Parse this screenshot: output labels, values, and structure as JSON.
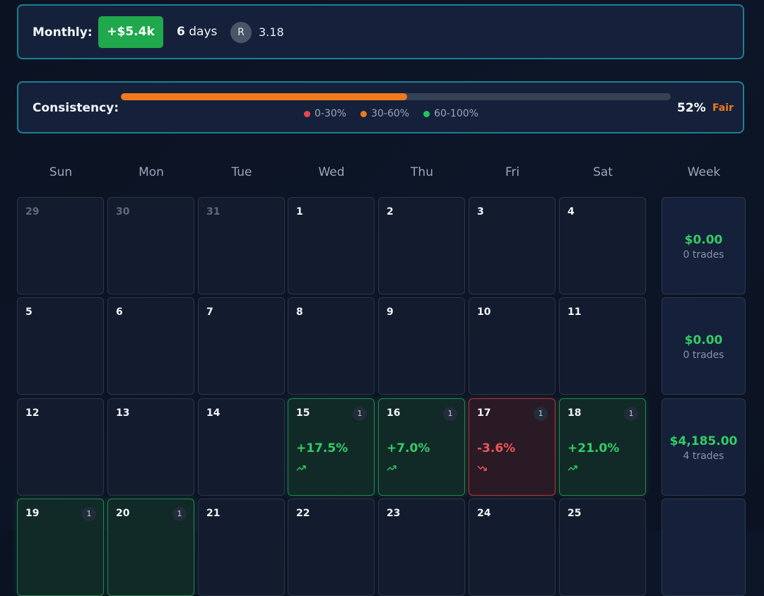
{
  "header": {
    "monthly_label": "Monthly:",
    "pnl": "+$5.4k",
    "days_value": "6",
    "days_unit": "days",
    "avatar_letter": "R",
    "ratio": "3.18"
  },
  "consistency": {
    "label": "Consistency:",
    "value": 0.52,
    "percent_text": "52%",
    "rating": "Fair",
    "legend": [
      {
        "label": "0-30%",
        "color": "#e5484d"
      },
      {
        "label": "30-60%",
        "color": "#f07a1c"
      },
      {
        "label": "60-100%",
        "color": "#22c55e"
      }
    ]
  },
  "weekdays": [
    "Sun",
    "Mon",
    "Tue",
    "Wed",
    "Thu",
    "Fri",
    "Sat"
  ],
  "week_header": "Week",
  "calendar": [
    [
      {
        "day": "29",
        "faded": true
      },
      {
        "day": "30",
        "faded": true
      },
      {
        "day": "31",
        "faded": true
      },
      {
        "day": "1"
      },
      {
        "day": "2"
      },
      {
        "day": "3"
      },
      {
        "day": "4"
      }
    ],
    [
      {
        "day": "5"
      },
      {
        "day": "6"
      },
      {
        "day": "7"
      },
      {
        "day": "8"
      },
      {
        "day": "9"
      },
      {
        "day": "10"
      },
      {
        "day": "11"
      }
    ],
    [
      {
        "day": "12"
      },
      {
        "day": "13"
      },
      {
        "day": "14"
      },
      {
        "day": "15",
        "trades": "1",
        "return": "+17.5%",
        "status": "pos"
      },
      {
        "day": "16",
        "trades": "1",
        "return": "+7.0%",
        "status": "pos"
      },
      {
        "day": "17",
        "trades": "1",
        "return": "-3.6%",
        "status": "neg"
      },
      {
        "day": "18",
        "trades": "1",
        "return": "+21.0%",
        "status": "pos"
      }
    ],
    [
      {
        "day": "19",
        "trades": "1",
        "status": "pos"
      },
      {
        "day": "20",
        "trades": "1",
        "status": "pos"
      },
      {
        "day": "21"
      },
      {
        "day": "22"
      },
      {
        "day": "23"
      },
      {
        "day": "24"
      },
      {
        "day": "25"
      }
    ]
  ],
  "weeks": [
    {
      "amount": "$0.00",
      "trades": "0 trades"
    },
    {
      "amount": "$0.00",
      "trades": "0 trades"
    },
    {
      "amount": "$4,185.00",
      "trades": "4 trades"
    },
    {
      "amount": "",
      "trades": ""
    }
  ]
}
